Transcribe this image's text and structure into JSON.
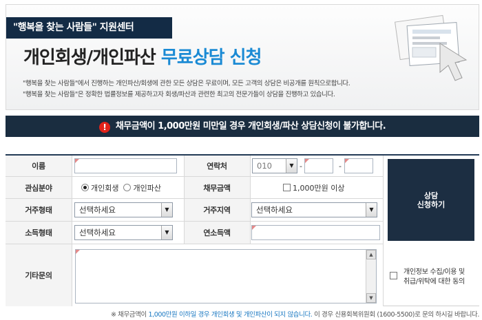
{
  "header": {
    "tag_quote": "\"행복을 찾는 사람들\"",
    "tag_suffix": "지원센터",
    "title_main": "개인회생/개인파산",
    "title_highlight": "무료상담 신청",
    "desc_line1": "\"행복을 찾는 사람들\"에서 진행하는 개인파산/회생에 관한 모든 상담은 무료이며, 모든 고객의 상담은 비공개를 원칙으로합니다.",
    "desc_line2": "\"행복을 찾는 사람들\"은 정확한 법률정보를 제공하고자 회생/파산과 관련한 최고의 전문가들이 상담을 진행하고 있습니다."
  },
  "notice": {
    "icon": "!",
    "text": "채무금액이 1,000만원 미만일 경우 개인회생/파산 상담신청이 불가합니다."
  },
  "form": {
    "name_label": "이름",
    "name_value": "",
    "contact_label": "연락처",
    "phone_prefix": "010",
    "phone_dash": "-",
    "phone_mid": "",
    "phone_last": "",
    "interest_label": "관심분야",
    "interest_option1": "개인회생",
    "interest_option2": "개인파산",
    "interest_selected": "개인회생",
    "debt_label": "채무금액",
    "debt_option": "1,000만원 이상",
    "residence_type_label": "거주형태",
    "residence_type_value": "선택하세요",
    "residence_area_label": "거주지역",
    "residence_area_value": "선택하세요",
    "income_type_label": "소득형태",
    "income_type_value": "선택하세요",
    "annual_income_label": "연소득액",
    "annual_income_value": "",
    "other_label": "기타문의",
    "other_value": "",
    "submit_line1": "상담",
    "submit_line2": "신청하기",
    "consent_line1": "개인정보 수집/이용 및",
    "consent_line2": "취급/위탁에 대한 동의"
  },
  "footnote": {
    "prefix": "※ 채무금액이",
    "blue": "1,000만원 이하일 경우 개인회생 및 개인파산이 되지 않습니다.",
    "suffix": "이 경우 신용회복위원회 (1600-5500)로 문의 하시길 바랍니다."
  },
  "colors": {
    "navy": "#1a2d40",
    "accent_blue": "#1a8ad4",
    "warning_red": "#e2231a"
  }
}
